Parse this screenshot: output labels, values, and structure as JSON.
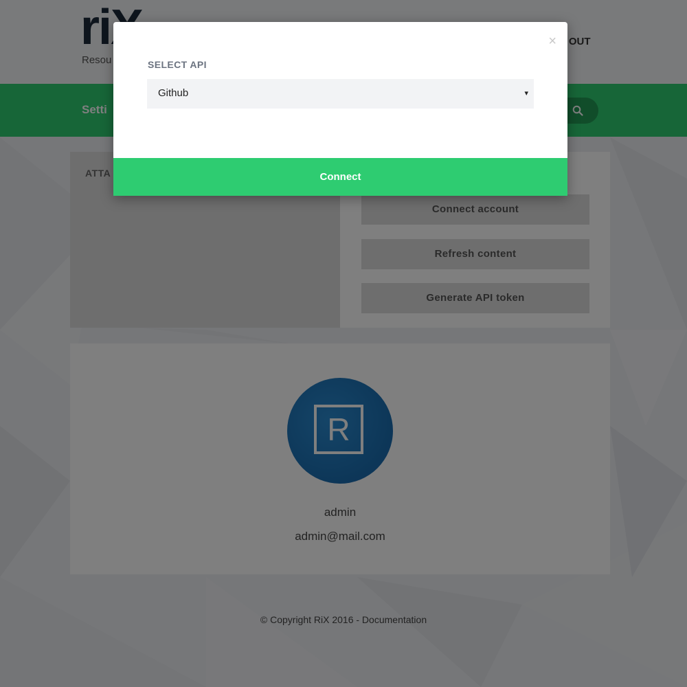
{
  "header": {
    "logo": "riX",
    "logo_subtitle": "Resou",
    "logout_label": "G OUT"
  },
  "navbar": {
    "title": "Setti",
    "search_icon": "search-icon"
  },
  "attachments_panel": {
    "title": "ATTA"
  },
  "actions": {
    "connect_account": "Connect account",
    "refresh_content": "Refresh content",
    "generate_api_token": "Generate API token"
  },
  "profile": {
    "avatar_letter": "R",
    "name": "admin",
    "email": "admin@mail.com"
  },
  "footer": {
    "text": "© Copyright RiX 2016 - Documentation"
  },
  "modal": {
    "close_symbol": "×",
    "label": "SELECT API",
    "select_value": "Github",
    "select_caret": "▾",
    "connect_label": "Connect"
  },
  "colors": {
    "accent_green": "#2ecc71",
    "dark_green": "#239a55",
    "avatar_blue": "#1a6db0"
  }
}
